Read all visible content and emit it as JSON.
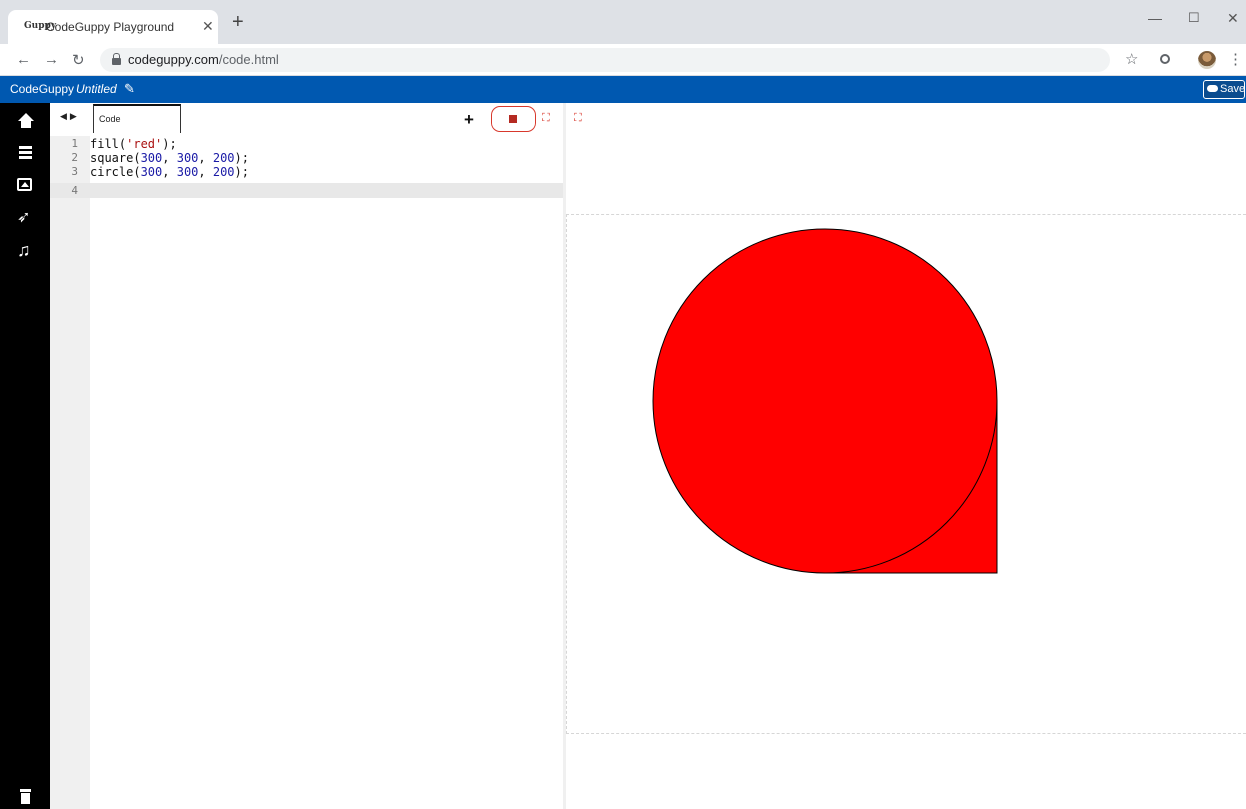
{
  "browser": {
    "tab_title": "CodeGuppy Playground",
    "tab_favicon": "Guppy",
    "url_host": "codeguppy.com",
    "url_path": "/code.html"
  },
  "app": {
    "brand": "CodeGuppy",
    "file_name": "Untitled",
    "save_label": "Save"
  },
  "editor": {
    "tab_label": "Code",
    "lines": [
      {
        "num": "1",
        "code": "fill('red');"
      },
      {
        "num": "2",
        "code": "square(300, 300, 200);"
      },
      {
        "num": "3",
        "code": "circle(300, 300, 200);"
      },
      {
        "num": "4",
        "code": ""
      }
    ]
  },
  "canvas": {
    "fill_color": "#ff0000",
    "stroke_color": "#000000"
  }
}
